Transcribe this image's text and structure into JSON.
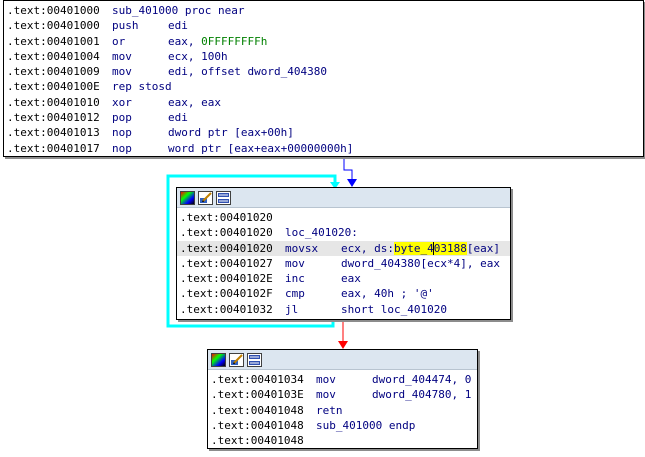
{
  "colors": {
    "flow_next": "#0000ff",
    "flow_false": "#ff0000",
    "flow_loop": "#00ffff",
    "mnemonic": "#000080",
    "number": "#008000",
    "highlight": "#ffff00",
    "toolbar_bg": "#dce6f0"
  },
  "icons": [
    "graph-colors-icon",
    "edit-block-icon",
    "group-nodes-icon"
  ],
  "blocks": [
    {
      "id": "block1",
      "lines": [
        {
          "addr": ".text:00401000",
          "mn": "sub_401000 proc near",
          "ops": ""
        },
        {
          "addr": ".text:00401000",
          "mn": "push",
          "ops": "edi"
        },
        {
          "addr": ".text:00401001",
          "mn": "or",
          "ops": "eax, ",
          "num": "0FFFFFFFFh"
        },
        {
          "addr": ".text:00401004",
          "mn": "mov",
          "ops": "ecx, 100h"
        },
        {
          "addr": ".text:00401009",
          "mn": "mov",
          "ops": "edi, offset dword_404380"
        },
        {
          "addr": ".text:0040100E",
          "mn": "rep stosd",
          "ops": ""
        },
        {
          "addr": ".text:00401010",
          "mn": "xor",
          "ops": "eax, eax"
        },
        {
          "addr": ".text:00401012",
          "mn": "pop",
          "ops": "edi"
        },
        {
          "addr": ".text:00401013",
          "mn": "nop",
          "ops": "dword ptr [eax+00h]"
        },
        {
          "addr": ".text:00401017",
          "mn": "nop",
          "ops": "word ptr [eax+eax+00000000h]"
        }
      ]
    },
    {
      "id": "block2",
      "lines": [
        {
          "addr": ".text:00401020",
          "mn": "",
          "ops": ""
        },
        {
          "addr": ".text:00401020",
          "mn": "loc_401020:",
          "ops": ""
        },
        {
          "addr": ".text:00401020",
          "mn": "movsx",
          "ops_pre": "ecx, ds:",
          "ops_hl_a": "byte_4",
          "ops_hl_b": "03188",
          "ops_post": "[eax]"
        },
        {
          "addr": ".text:00401027",
          "mn": "mov",
          "ops": "dword_404380[ecx*4], eax"
        },
        {
          "addr": ".text:0040102E",
          "mn": "inc",
          "ops": "eax"
        },
        {
          "addr": ".text:0040102F",
          "mn": "cmp",
          "ops": "eax, 40h ; '@'"
        },
        {
          "addr": ".text:00401032",
          "mn": "jl",
          "ops": "short loc_401020"
        }
      ]
    },
    {
      "id": "block3",
      "lines": [
        {
          "addr": ".text:00401034",
          "mn": "mov",
          "ops": "dword_404474, 0"
        },
        {
          "addr": ".text:0040103E",
          "mn": "mov",
          "ops": "dword_404780, 1"
        },
        {
          "addr": ".text:00401048",
          "mn": "retn",
          "ops": ""
        },
        {
          "addr": ".text:00401048",
          "mn": "sub_401000 endp",
          "ops": ""
        },
        {
          "addr": ".text:00401048",
          "mn": "",
          "ops": ""
        }
      ]
    }
  ]
}
